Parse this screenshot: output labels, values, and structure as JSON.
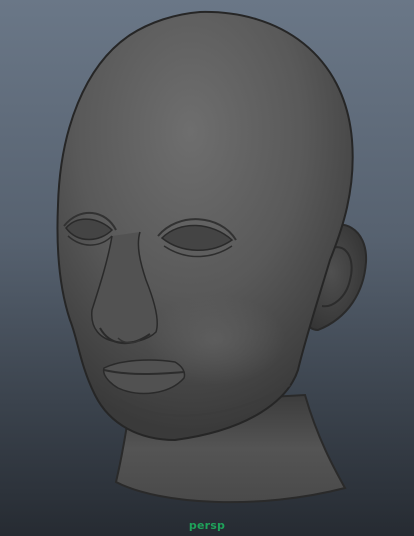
{
  "viewport": {
    "camera_name": "persp",
    "model_icon": "head-mesh-icon",
    "colors": {
      "background_top": "#6a7787",
      "background_bottom": "#262b32",
      "mesh_base": "#5a5a5a",
      "mesh_shadow": "#2a2a2a",
      "mesh_highlight": "#6e6e6e",
      "camera_label": "#1fa25a"
    }
  }
}
